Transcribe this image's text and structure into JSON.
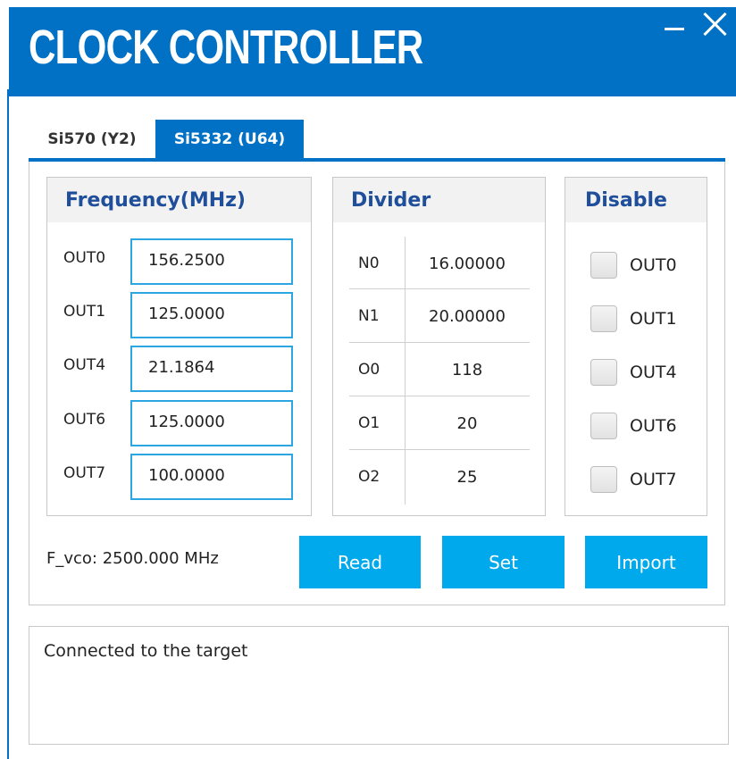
{
  "window": {
    "title": "CLOCK CONTROLLER",
    "accent_color": "#0071c5",
    "button_color": "#00a8ec"
  },
  "tabs": [
    {
      "label": "Si570 (Y2)",
      "active": false
    },
    {
      "label": "Si5332 (U64)",
      "active": true
    }
  ],
  "frequency": {
    "header": "Frequency(MHz)",
    "rows": [
      {
        "label": "OUT0",
        "value": "156.2500"
      },
      {
        "label": "OUT1",
        "value": "125.0000"
      },
      {
        "label": "OUT4",
        "value": "21.1864"
      },
      {
        "label": "OUT6",
        "value": "125.0000"
      },
      {
        "label": "OUT7",
        "value": "100.0000"
      }
    ]
  },
  "divider": {
    "header": "Divider",
    "rows": [
      {
        "name": "N0",
        "value": "16.00000"
      },
      {
        "name": "N1",
        "value": "20.00000"
      },
      {
        "name": "O0",
        "value": "118"
      },
      {
        "name": "O1",
        "value": "20"
      },
      {
        "name": "O2",
        "value": "25"
      }
    ]
  },
  "disable": {
    "header": "Disable",
    "items": [
      {
        "label": "OUT0",
        "checked": false
      },
      {
        "label": "OUT1",
        "checked": false
      },
      {
        "label": "OUT4",
        "checked": false
      },
      {
        "label": "OUT6",
        "checked": false
      },
      {
        "label": "OUT7",
        "checked": false
      }
    ]
  },
  "fvco": "F_vco:  2500.000 MHz",
  "buttons": {
    "read": "Read",
    "set": "Set",
    "import": "Import"
  },
  "status": "Connected to the target"
}
